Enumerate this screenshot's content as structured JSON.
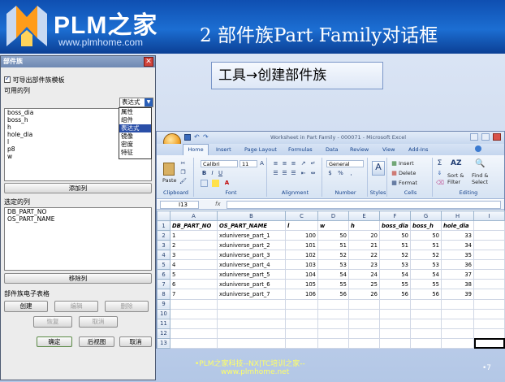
{
  "header": {
    "brand": "PLM之家",
    "website": "www.plmhome.com",
    "slide_title": "2 部件族Part Family对话框"
  },
  "menu_path": {
    "first": "工具",
    "arrow": "→",
    "second": "创建部件族"
  },
  "dialog": {
    "title": "部件族",
    "close": "✕",
    "checkbox_label": "可导出部件族模板",
    "available_columns_label": "可用的列",
    "dropdown_value": "表达式",
    "dropdown_arrow": "▼",
    "dropdown_options": [
      "属性",
      "组件",
      "表达式",
      "镜像",
      "密度",
      "特征"
    ],
    "available_items": [
      "boss_dia",
      "boss_h",
      "h",
      "hole_dia",
      "l",
      "p8",
      "w"
    ],
    "add_column_button": "添加列",
    "selected_columns_label": "选定的列",
    "selected_items": [
      "DB_PART_NO",
      "OS_PART_NAME"
    ],
    "remove_column_button": "移除列",
    "spreadsheet_label": "部件族电子表格",
    "create_button": "创建",
    "edit_button": "编辑",
    "delete_button": "删除",
    "restore_button": "恢复",
    "cancel_small_button": "取消",
    "ok_button": "确定",
    "back_button": "后视图",
    "cancel_button": "取消"
  },
  "excel": {
    "window_title": "Worksheet in Part Family - 000071 - Microsoft Excel",
    "tabs": [
      "Home",
      "Insert",
      "Page Layout",
      "Formulas",
      "Data",
      "Review",
      "View",
      "Add-Ins"
    ],
    "clipboard": {
      "paste": "Paste",
      "label": "Clipboard"
    },
    "font": {
      "name": "Calibri",
      "size": "11",
      "label": "Font",
      "bold": "B",
      "italic": "I",
      "underline": "U",
      "grow": "A",
      "color": "A"
    },
    "alignment": {
      "label": "Alignment"
    },
    "number": {
      "format": "General",
      "label": "Number",
      "currency": "$",
      "percent": "%",
      "comma": ","
    },
    "styles": {
      "label": "Styles",
      "letter": "A"
    },
    "cells": {
      "insert": "Insert",
      "delete": "Delete",
      "format": "Format",
      "label": "Cells"
    },
    "editing": {
      "sort": "Sort &",
      "filter": "Filter",
      "find": "Find &",
      "select": "Select",
      "label": "Editing",
      "sigma": "Σ"
    },
    "name_box": "I13",
    "fx": "fx",
    "columns": [
      "A",
      "B",
      "C",
      "D",
      "E",
      "F",
      "G",
      "H",
      "I"
    ],
    "rows": [
      [
        "DB_PART_NO",
        "OS_PART_NAME",
        "l",
        "w",
        "h",
        "boss_dia",
        "boss_h",
        "hole_dia",
        ""
      ],
      [
        "1",
        "xduniverse_part_1",
        "100",
        "50",
        "20",
        "50",
        "50",
        "33",
        ""
      ],
      [
        "2",
        "xduniverse_part_2",
        "101",
        "51",
        "21",
        "51",
        "51",
        "34",
        ""
      ],
      [
        "3",
        "xduniverse_part_3",
        "102",
        "52",
        "22",
        "52",
        "52",
        "35",
        ""
      ],
      [
        "4",
        "xduniverse_part_4",
        "103",
        "53",
        "23",
        "53",
        "53",
        "36",
        ""
      ],
      [
        "5",
        "xduniverse_part_5",
        "104",
        "54",
        "24",
        "54",
        "54",
        "37",
        ""
      ],
      [
        "6",
        "xduniverse_part_6",
        "105",
        "55",
        "25",
        "55",
        "55",
        "38",
        ""
      ],
      [
        "7",
        "xduniverse_part_7",
        "106",
        "56",
        "26",
        "56",
        "56",
        "39",
        ""
      ],
      [
        "",
        "",
        "",
        "",
        "",
        "",
        "",
        "",
        ""
      ],
      [
        "",
        "",
        "",
        "",
        "",
        "",
        "",
        "",
        ""
      ],
      [
        "",
        "",
        "",
        "",
        "",
        "",
        "",
        "",
        ""
      ],
      [
        "",
        "",
        "",
        "",
        "",
        "",
        "",
        "",
        ""
      ],
      [
        "",
        "",
        "",
        "",
        "",
        "",
        "",
        "",
        ""
      ]
    ]
  },
  "footer": {
    "line1": "•PLM之家科技--NX|TC培训之家--",
    "line2": "www.plmhome.net",
    "page_number": "•7"
  },
  "colors": {
    "header_blue": "#1c6ed2",
    "footer_yellow": "#ffff66",
    "selection_blue": "#2a4fa8"
  }
}
